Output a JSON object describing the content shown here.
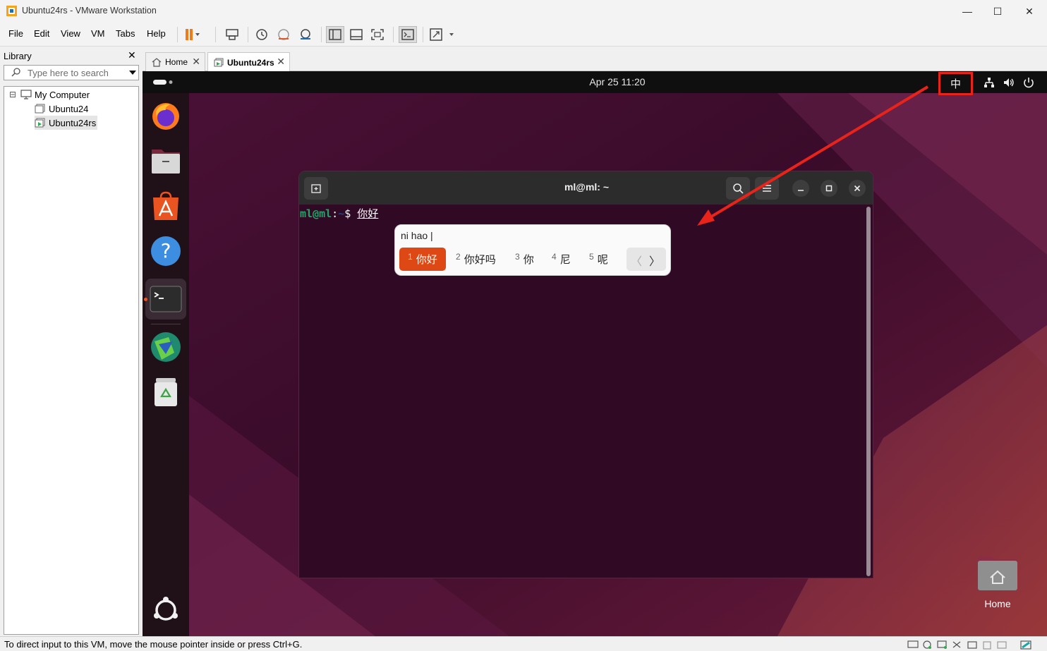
{
  "window": {
    "title": "Ubuntu24rs - VMware Workstation",
    "minimize": "—",
    "maximize": "☐",
    "close": "✕"
  },
  "menu": {
    "file": "File",
    "edit": "Edit",
    "view": "View",
    "vm": "VM",
    "tabs": "Tabs",
    "help": "Help"
  },
  "library": {
    "header": "Library",
    "close": "✕",
    "search_placeholder": "Type here to search",
    "tree": {
      "root": "My Computer",
      "items": [
        "Ubuntu24",
        "Ubuntu24rs"
      ],
      "expander": "⊟"
    }
  },
  "tabs": [
    {
      "label": "Home",
      "close": "✕"
    },
    {
      "label": "Ubuntu24rs",
      "close": "✕"
    }
  ],
  "ubuntu": {
    "clock": "Apr 25  11:20",
    "ime_indicator": "中",
    "desktop_home_label": "Home"
  },
  "terminal": {
    "title": "ml@ml: ~",
    "prompt_user": "ml@ml",
    "prompt_sep": ":",
    "prompt_path": "~",
    "prompt_dollar": "$ ",
    "preedit": "你好"
  },
  "ime": {
    "preedit": "ni hao |",
    "candidates": [
      {
        "num": "1",
        "text": "你好",
        "selected": true
      },
      {
        "num": "2",
        "text": "你好吗",
        "selected": false
      },
      {
        "num": "3",
        "text": "你",
        "selected": false
      },
      {
        "num": "4",
        "text": "尼",
        "selected": false
      },
      {
        "num": "5",
        "text": "呢",
        "selected": false
      }
    ],
    "prev": "〈",
    "next": "〉"
  },
  "status": {
    "text": "To direct input to this VM, move the mouse pointer inside or press Ctrl+G."
  },
  "colors": {
    "accent_orange": "#dd4814",
    "annotation_red": "#e8231a",
    "terminal_bg": "#300a24"
  }
}
